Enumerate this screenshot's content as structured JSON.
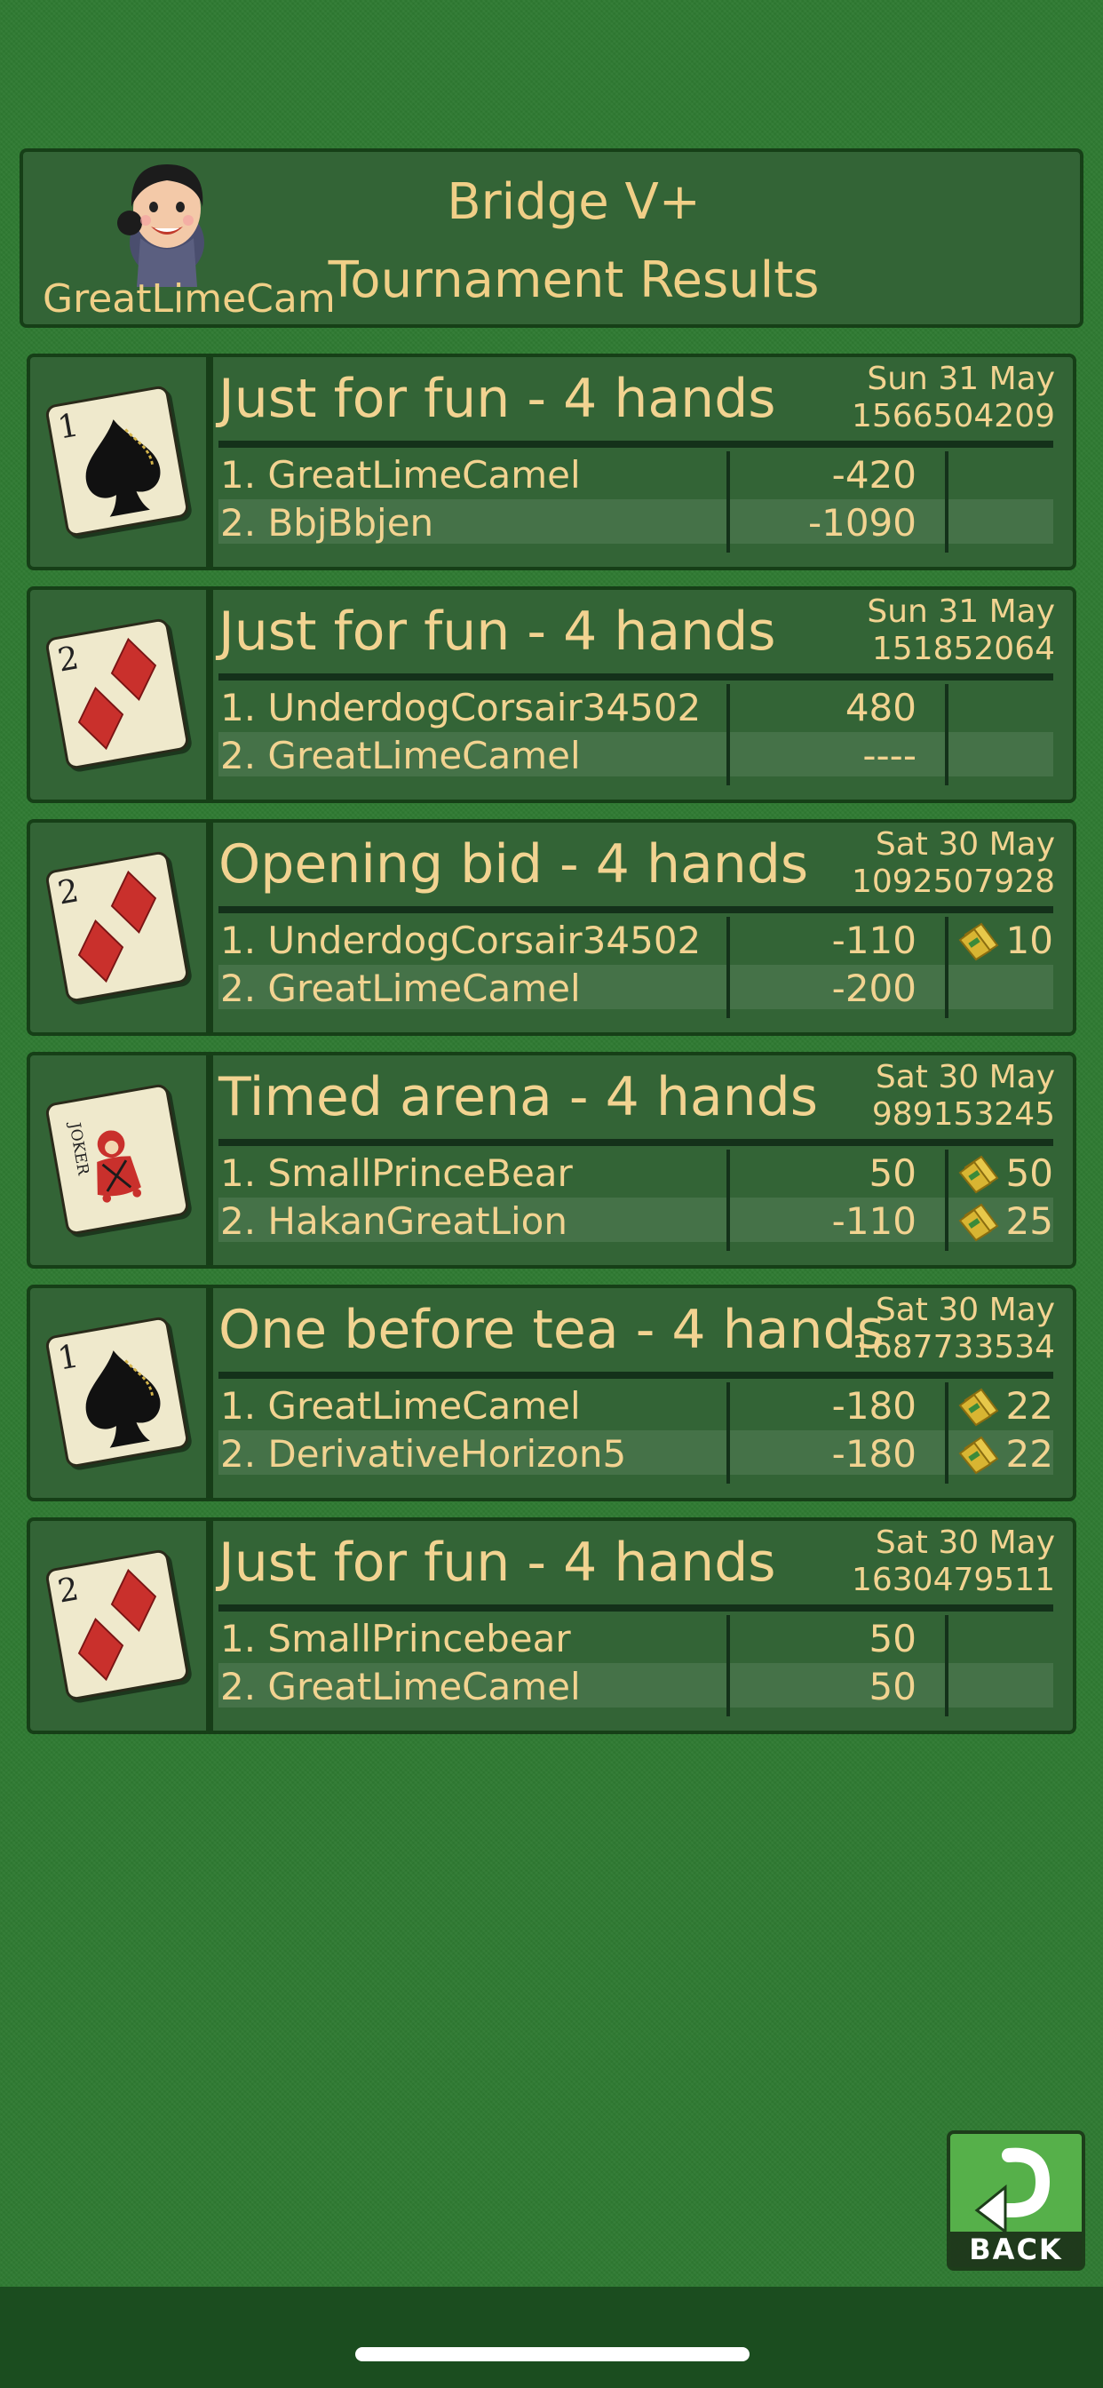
{
  "header": {
    "user_name": "GreatLimeCam",
    "title_line1": "Bridge V+",
    "title_line2": "Tournament Results"
  },
  "results": [
    {
      "card": {
        "rank": "1",
        "suit": "spade"
      },
      "title": "Just for fun - 4 hands",
      "date": "Sun 31 May",
      "id": "1566504209",
      "players": [
        {
          "name": "1. GreatLimeCamel",
          "score": "-420",
          "reward": ""
        },
        {
          "name": "2. BbjBbjen",
          "score": "-1090",
          "reward": ""
        }
      ]
    },
    {
      "card": {
        "rank": "2",
        "suit": "diamond"
      },
      "title": "Just for fun - 4 hands",
      "date": "Sun 31 May",
      "id": "151852064",
      "players": [
        {
          "name": "1. UnderdogCorsair34502",
          "score": "480",
          "reward": ""
        },
        {
          "name": "2. GreatLimeCamel",
          "score": "----",
          "reward": ""
        }
      ]
    },
    {
      "card": {
        "rank": "2",
        "suit": "diamond"
      },
      "title": "Opening bid - 4 hands",
      "date": "Sat 30 May",
      "id": "1092507928",
      "players": [
        {
          "name": "1. UnderdogCorsair34502",
          "score": "-110",
          "reward": "10"
        },
        {
          "name": "2. GreatLimeCamel",
          "score": "-200",
          "reward": ""
        }
      ]
    },
    {
      "card": {
        "rank": "JOKER",
        "suit": "joker"
      },
      "title": "Timed arena - 4 hands",
      "date": "Sat 30 May",
      "id": "989153245",
      "players": [
        {
          "name": "1. SmallPrinceBear",
          "score": "50",
          "reward": "50"
        },
        {
          "name": "2. HakanGreatLion",
          "score": "-110",
          "reward": "25"
        }
      ]
    },
    {
      "card": {
        "rank": "1",
        "suit": "spade"
      },
      "title": "One before tea - 4 hands",
      "date": "Sat 30 May",
      "id": "1687733534",
      "players": [
        {
          "name": "1. GreatLimeCamel",
          "score": "-180",
          "reward": "22"
        },
        {
          "name": "2. DerivativeHorizon5",
          "score": "-180",
          "reward": "22"
        }
      ]
    },
    {
      "card": {
        "rank": "2",
        "suit": "diamond"
      },
      "title": "Just for fun - 4 hands",
      "date": "Sat 30 May",
      "id": "1630479511",
      "players": [
        {
          "name": "1. SmallPrincebear",
          "score": "50",
          "reward": ""
        },
        {
          "name": "2. GreatLimeCamel",
          "score": "50",
          "reward": ""
        }
      ]
    }
  ],
  "back_button": {
    "label": "BACK"
  },
  "colors": {
    "background": "#2f7a32",
    "panel": "#336436",
    "text": "#f2d391",
    "button": "#56b04a"
  }
}
